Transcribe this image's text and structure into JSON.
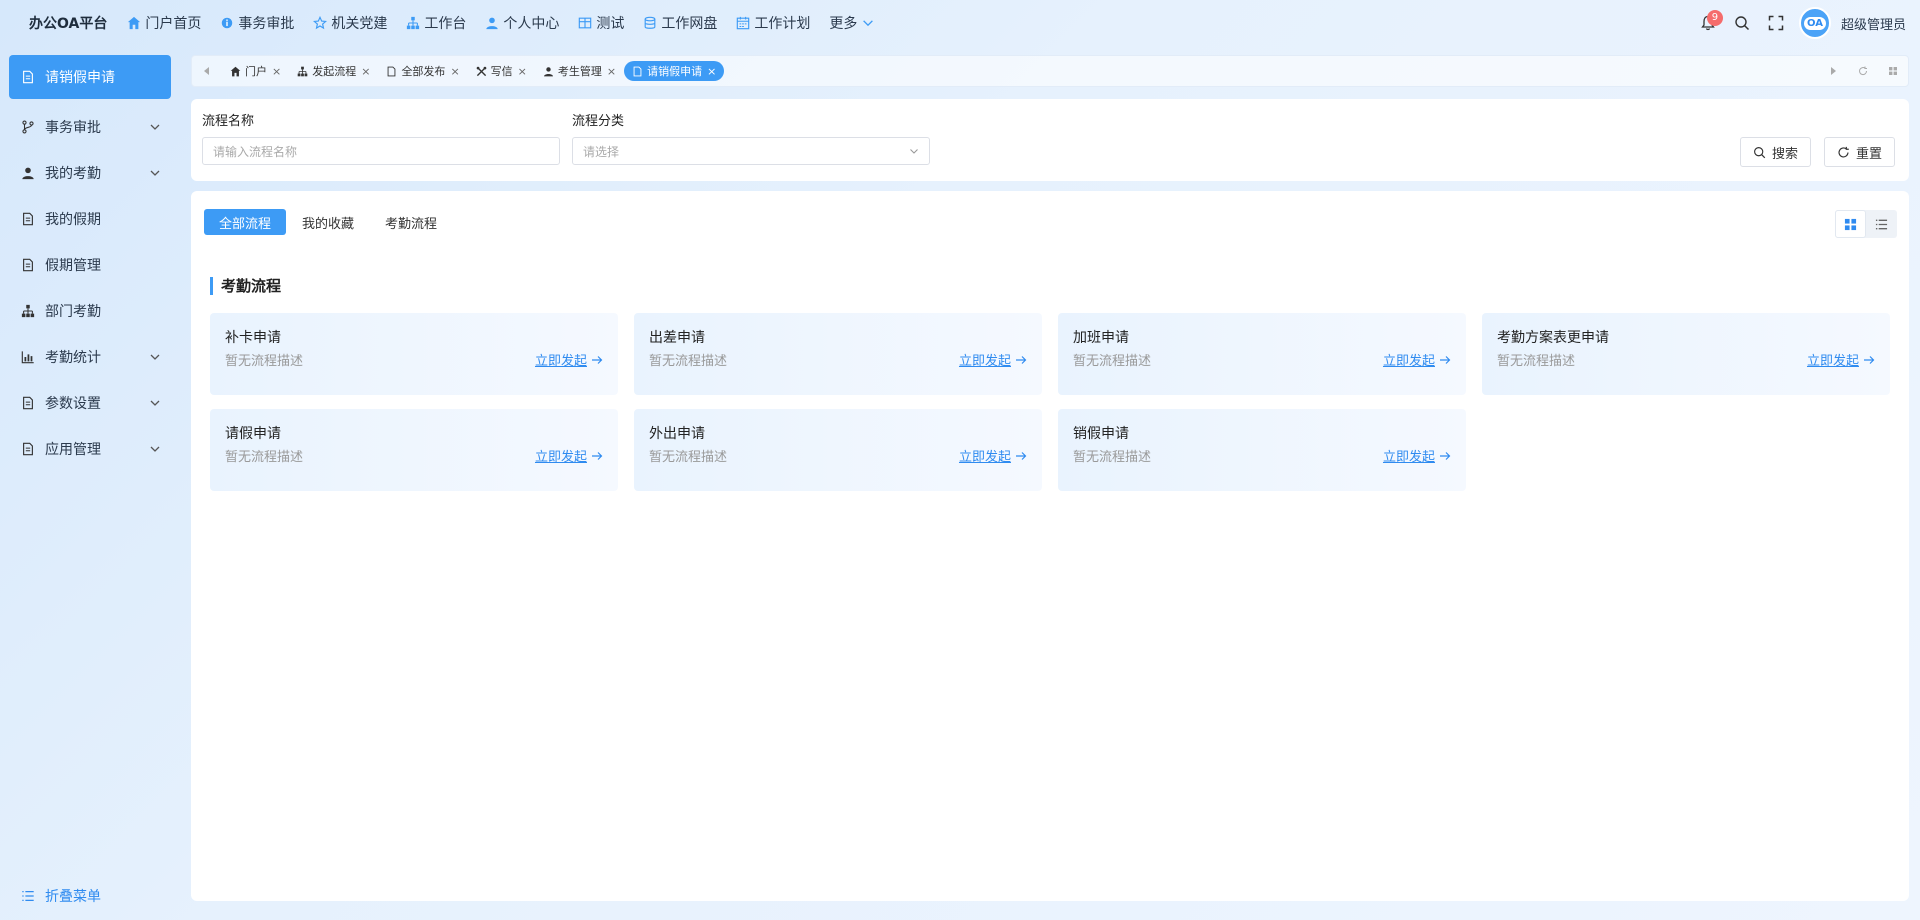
{
  "app": {
    "title": "办公OA平台"
  },
  "topnav": {
    "items": [
      {
        "label": "门户首页",
        "icon": "home-icon"
      },
      {
        "label": "事务审批",
        "icon": "info-icon"
      },
      {
        "label": "机关党建",
        "icon": "star-icon"
      },
      {
        "label": "工作台",
        "icon": "org-icon"
      },
      {
        "label": "个人中心",
        "icon": "user-icon"
      },
      {
        "label": "测试",
        "icon": "grid-icon"
      },
      {
        "label": "工作网盘",
        "icon": "database-icon"
      },
      {
        "label": "工作计划",
        "icon": "calendar-icon"
      },
      {
        "label": "更多",
        "icon": "chevron-down-icon"
      }
    ]
  },
  "header": {
    "notifications": "9",
    "avatar_text": "OA",
    "username": "超级管理员"
  },
  "sidebar": {
    "items": [
      {
        "label": "请销假申请"
      },
      {
        "label": "事务审批"
      },
      {
        "label": "我的考勤"
      },
      {
        "label": "我的假期"
      },
      {
        "label": "假期管理"
      },
      {
        "label": "部门考勤"
      },
      {
        "label": "考勤统计"
      },
      {
        "label": "参数设置"
      },
      {
        "label": "应用管理"
      }
    ],
    "collapse_label": "折叠菜单"
  },
  "tabs": [
    {
      "label": "门户"
    },
    {
      "label": "发起流程"
    },
    {
      "label": "全部发布"
    },
    {
      "label": "写信"
    },
    {
      "label": "考生管理"
    },
    {
      "label": "请销假申请"
    }
  ],
  "filter": {
    "name_label": "流程名称",
    "name_placeholder": "请输入流程名称",
    "category_label": "流程分类",
    "category_placeholder": "请选择",
    "search_label": "搜索",
    "reset_label": "重置"
  },
  "panel": {
    "subtabs": [
      "全部流程",
      "我的收藏",
      "考勤流程"
    ],
    "section_title": "考勤流程",
    "cards": [
      {
        "name": "补卡申请",
        "desc": "暂无流程描述",
        "action": "立即发起"
      },
      {
        "name": "出差申请",
        "desc": "暂无流程描述",
        "action": "立即发起"
      },
      {
        "name": "加班申请",
        "desc": "暂无流程描述",
        "action": "立即发起"
      },
      {
        "name": "考勤方案表更申请",
        "desc": "暂无流程描述",
        "action": "立即发起"
      },
      {
        "name": "请假申请",
        "desc": "暂无流程描述",
        "action": "立即发起"
      },
      {
        "name": "外出申请",
        "desc": "暂无流程描述",
        "action": "立即发起"
      },
      {
        "name": "销假申请",
        "desc": "暂无流程描述",
        "action": "立即发起"
      }
    ]
  },
  "colors": {
    "accent": "#3d9bf5",
    "link": "#2f8bf0",
    "badge": "#f56c6c"
  }
}
